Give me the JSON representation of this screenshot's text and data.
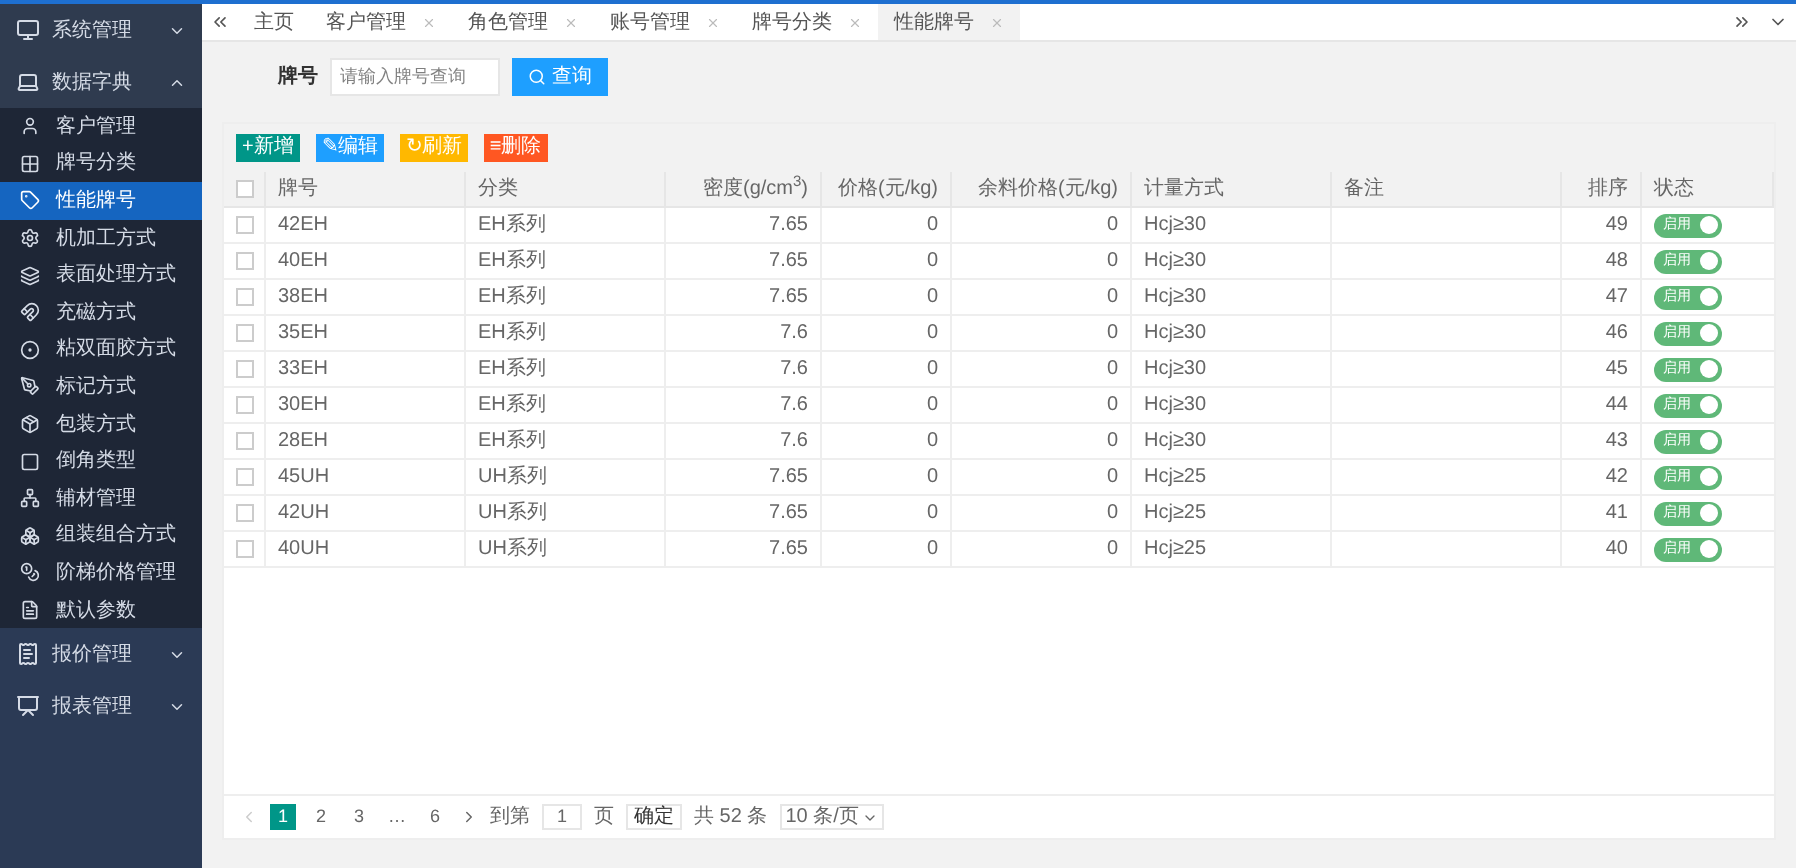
{
  "sidebar": {
    "groups": [
      {
        "label": "系统管理",
        "expanded": false
      },
      {
        "label": "数据字典",
        "expanded": true,
        "children": [
          {
            "label": "客户管理",
            "selected": false
          },
          {
            "label": "牌号分类",
            "selected": false
          },
          {
            "label": "性能牌号",
            "selected": true
          },
          {
            "label": "机加工方式",
            "selected": false
          },
          {
            "label": "表面处理方式",
            "selected": false
          },
          {
            "label": "充磁方式",
            "selected": false
          },
          {
            "label": "粘双面胶方式",
            "selected": false
          },
          {
            "label": "标记方式",
            "selected": false
          },
          {
            "label": "包装方式",
            "selected": false
          },
          {
            "label": "倒角类型",
            "selected": false
          },
          {
            "label": "辅材管理",
            "selected": false
          },
          {
            "label": "组装组合方式",
            "selected": false
          },
          {
            "label": "阶梯价格管理",
            "selected": false
          },
          {
            "label": "默认参数",
            "selected": false
          }
        ]
      },
      {
        "label": "报价管理",
        "expanded": false
      },
      {
        "label": "报表管理",
        "expanded": false
      }
    ]
  },
  "tabs": [
    {
      "label": "主页",
      "closable": false,
      "selected": false
    },
    {
      "label": "客户管理",
      "closable": true,
      "selected": false
    },
    {
      "label": "角色管理",
      "closable": true,
      "selected": false
    },
    {
      "label": "账号管理",
      "closable": true,
      "selected": false
    },
    {
      "label": "牌号分类",
      "closable": true,
      "selected": false
    },
    {
      "label": "性能牌号",
      "closable": true,
      "selected": true
    }
  ],
  "search": {
    "label": "牌号",
    "placeholder": "请输入牌号查询",
    "button": "查询"
  },
  "toolbar": [
    {
      "kind": "add",
      "label": "+新增"
    },
    {
      "kind": "edit",
      "label": "✎编辑"
    },
    {
      "kind": "refresh",
      "label": "↻刷新"
    },
    {
      "kind": "delete",
      "label": "≡删除"
    }
  ],
  "table": {
    "header_checked": false,
    "columns": [
      "牌号",
      "分类",
      "密度(g/cm$^{3}$)",
      "价格(元/kg)",
      "余料价格(元/kg)",
      "计量方式",
      "备注",
      "排序",
      "状态"
    ],
    "rows": [
      {
        "checked": false,
        "cells": [
          "42EH",
          "EH系列",
          "7.65",
          "0",
          "0",
          "Hcj≥30",
          "",
          "49"
        ],
        "status": "启用",
        "enabled": true
      },
      {
        "checked": false,
        "cells": [
          "40EH",
          "EH系列",
          "7.65",
          "0",
          "0",
          "Hcj≥30",
          "",
          "48"
        ],
        "status": "启用",
        "enabled": true
      },
      {
        "checked": false,
        "cells": [
          "38EH",
          "EH系列",
          "7.65",
          "0",
          "0",
          "Hcj≥30",
          "",
          "47"
        ],
        "status": "启用",
        "enabled": true
      },
      {
        "checked": false,
        "cells": [
          "35EH",
          "EH系列",
          "7.6",
          "0",
          "0",
          "Hcj≥30",
          "",
          "46"
        ],
        "status": "启用",
        "enabled": true
      },
      {
        "checked": false,
        "cells": [
          "33EH",
          "EH系列",
          "7.6",
          "0",
          "0",
          "Hcj≥30",
          "",
          "45"
        ],
        "status": "启用",
        "enabled": true
      },
      {
        "checked": false,
        "cells": [
          "30EH",
          "EH系列",
          "7.6",
          "0",
          "0",
          "Hcj≥30",
          "",
          "44"
        ],
        "status": "启用",
        "enabled": true
      },
      {
        "checked": false,
        "cells": [
          "28EH",
          "EH系列",
          "7.6",
          "0",
          "0",
          "Hcj≥30",
          "",
          "43"
        ],
        "status": "启用",
        "enabled": true
      },
      {
        "checked": false,
        "cells": [
          "45UH",
          "UH系列",
          "7.65",
          "0",
          "0",
          "Hcj≥25",
          "",
          "42"
        ],
        "status": "启用",
        "enabled": true
      },
      {
        "checked": false,
        "cells": [
          "42UH",
          "UH系列",
          "7.65",
          "0",
          "0",
          "Hcj≥25",
          "",
          "41"
        ],
        "status": "启用",
        "enabled": true
      },
      {
        "checked": false,
        "cells": [
          "40UH",
          "UH系列",
          "7.65",
          "0",
          "0",
          "Hcj≥25",
          "",
          "40"
        ],
        "status": "启用",
        "enabled": true
      }
    ]
  },
  "pagination": {
    "pages": [
      {
        "label": "1",
        "selected": true
      },
      {
        "label": "2",
        "selected": false
      },
      {
        "label": "3",
        "selected": false
      },
      {
        "label": "…",
        "selected": false
      },
      {
        "label": "6",
        "selected": false
      }
    ],
    "goto_label": "到第",
    "goto_value": "1",
    "page_unit": "页",
    "confirm": "确定",
    "total": "共 52 条",
    "page_size": "10 条/页"
  }
}
